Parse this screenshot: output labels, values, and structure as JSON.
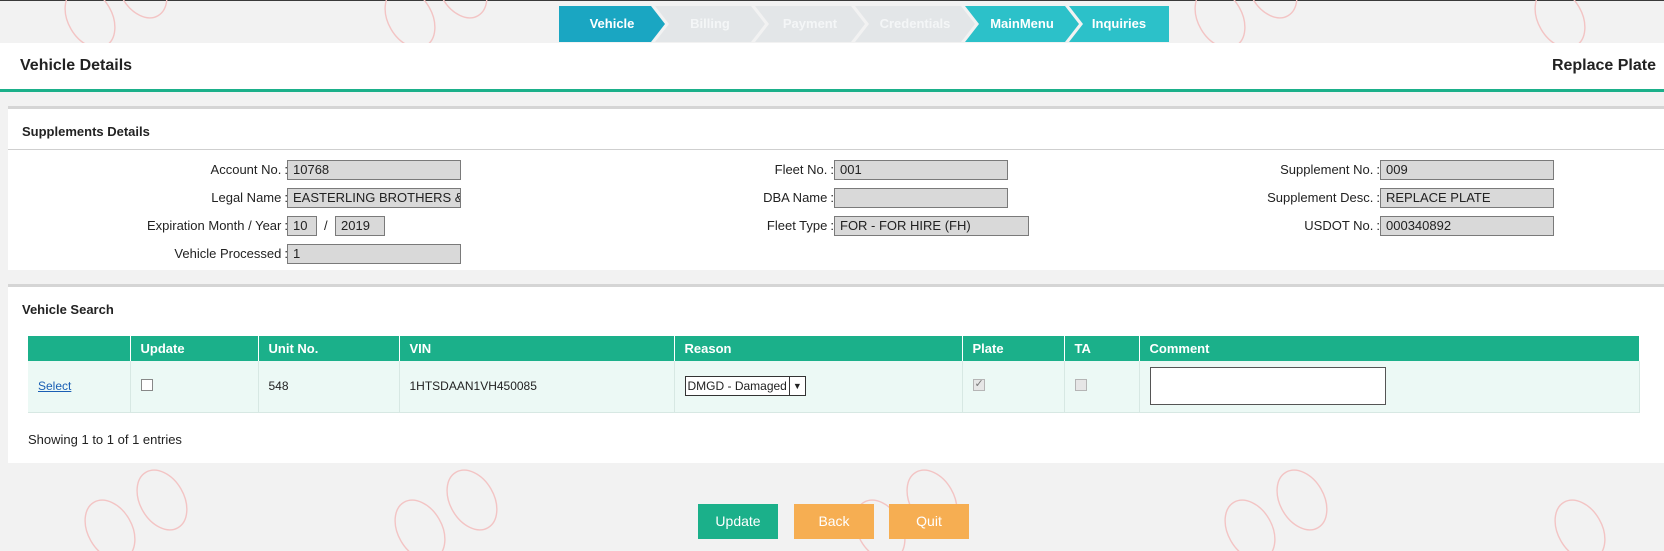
{
  "wizard": {
    "steps": [
      {
        "label": "Vehicle",
        "state": "active"
      },
      {
        "label": "Billing",
        "state": "disabled"
      },
      {
        "label": "Payment",
        "state": "disabled"
      },
      {
        "label": "Credentials",
        "state": "disabled"
      },
      {
        "label": "MainMenu",
        "state": "enabled"
      },
      {
        "label": "Inquiries",
        "state": "enabled"
      }
    ]
  },
  "header": {
    "title": "Vehicle Details",
    "action": "Replace Plate"
  },
  "supplements": {
    "title": "Supplements Details",
    "account_no": {
      "label": "Account No.",
      "value": "10768"
    },
    "legal_name": {
      "label": "Legal Name",
      "value": "EASTERLING BROTHERS & S"
    },
    "expiration": {
      "label": "Expiration Month / Year",
      "month": "10",
      "year": "2019",
      "separator": "/"
    },
    "vehicle_processed": {
      "label": "Vehicle Processed",
      "value": "1"
    },
    "fleet_no": {
      "label": "Fleet No.",
      "value": "001"
    },
    "dba_name": {
      "label": "DBA Name",
      "value": ""
    },
    "fleet_type": {
      "label": "Fleet Type",
      "value": "FOR - FOR HIRE (FH)"
    },
    "supplement_no": {
      "label": "Supplement No.",
      "value": "009"
    },
    "supplement_desc": {
      "label": "Supplement Desc.",
      "value": "REPLACE PLATE"
    },
    "usdot_no": {
      "label": "USDOT No.",
      "value": "000340892"
    }
  },
  "vehicle_search": {
    "title": "Vehicle Search",
    "columns": [
      "",
      "Update",
      "Unit No.",
      "VIN",
      "Reason",
      "Plate",
      "TA",
      "Comment"
    ],
    "rows": [
      {
        "select": "Select",
        "update": false,
        "unit_no": "548",
        "vin": "1HTSDAAN1VH450085",
        "reason": "DMGD - Damaged",
        "plate": true,
        "ta": false,
        "comment": ""
      }
    ],
    "showing": "Showing 1 to 1 of 1 entries"
  },
  "buttons": {
    "update": "Update",
    "back": "Back",
    "quit": "Quit"
  },
  "colors": {
    "accent": "#1bb08a",
    "wizard_active": "#1aa6c2",
    "wizard_enabled": "#2cc1c9",
    "button_secondary": "#f6ae52"
  }
}
